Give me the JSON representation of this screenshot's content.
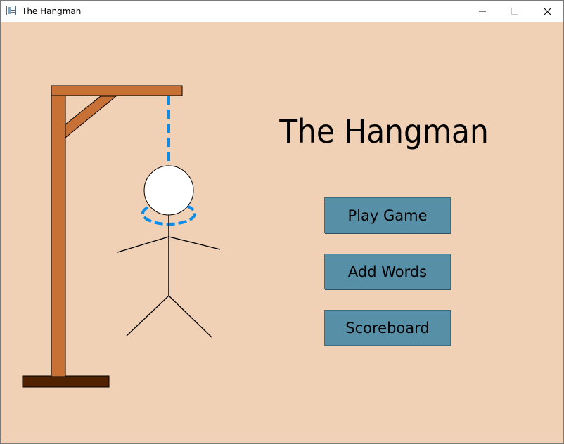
{
  "window": {
    "title": "The Hangman",
    "controls": {
      "minimize": "minimize-icon",
      "maximize": "maximize-icon",
      "close": "close-icon"
    }
  },
  "main": {
    "heading": "The Hangman",
    "buttons": [
      {
        "label": "Play Game"
      },
      {
        "label": "Add Words"
      },
      {
        "label": "Scoreboard"
      }
    ]
  },
  "colors": {
    "background": "#f0d1b6",
    "gallows_wood": "#c87137",
    "gallows_base": "#502200",
    "rope": "#0c8ce9",
    "button": "#568fa6"
  }
}
